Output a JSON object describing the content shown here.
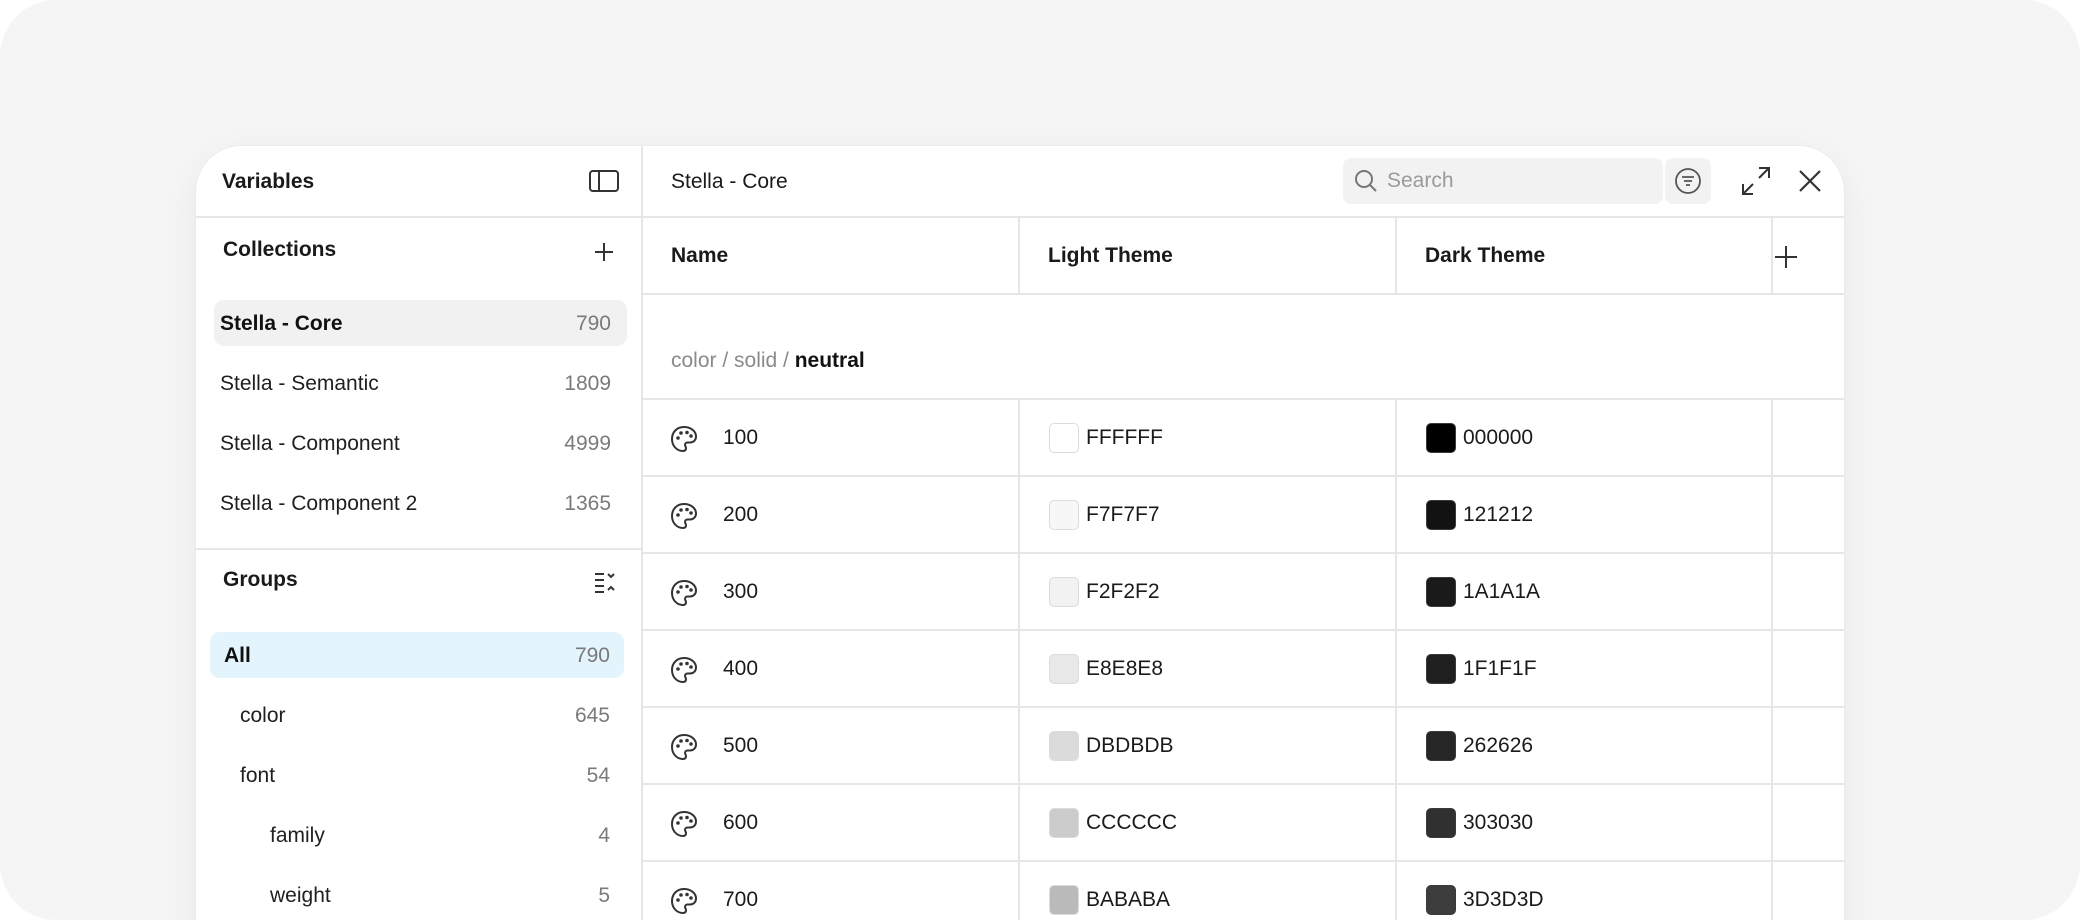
{
  "sidebar": {
    "title": "Variables",
    "collections": {
      "title": "Collections",
      "items": [
        {
          "label": "Stella - Core",
          "count": "790"
        },
        {
          "label": "Stella - Semantic",
          "count": "1809"
        },
        {
          "label": "Stella - Component",
          "count": "4999"
        },
        {
          "label": "Stella - Component 2",
          "count": "1365"
        }
      ]
    },
    "groups": {
      "title": "Groups",
      "items": [
        {
          "label": "All",
          "count": "790"
        },
        {
          "label": "color",
          "count": "645"
        },
        {
          "label": "font",
          "count": "54"
        },
        {
          "label": "family",
          "count": "4"
        },
        {
          "label": "weight",
          "count": "5"
        }
      ]
    }
  },
  "main": {
    "title": "Stella - Core",
    "search": {
      "placeholder": "Search",
      "value": ""
    },
    "columns": [
      "Name",
      "Light Theme",
      "Dark Theme"
    ],
    "group_path": {
      "prefix": "color / solid / ",
      "current": "neutral"
    },
    "rows": [
      {
        "name": "100",
        "light": "FFFFFF",
        "dark": "000000"
      },
      {
        "name": "200",
        "light": "F7F7F7",
        "dark": "121212"
      },
      {
        "name": "300",
        "light": "F2F2F2",
        "dark": "1A1A1A"
      },
      {
        "name": "400",
        "light": "E8E8E8",
        "dark": "1F1F1F"
      },
      {
        "name": "500",
        "light": "DBDBDB",
        "dark": "262626"
      },
      {
        "name": "600",
        "light": "CCCCCC",
        "dark": "303030"
      },
      {
        "name": "700",
        "light": "BABABA",
        "dark": "3D3D3D"
      }
    ]
  },
  "colors": {
    "selected_collection_bg": "#f1f1f1",
    "selected_group_bg": "#e3f4fc",
    "border": "#e6e6e6"
  }
}
